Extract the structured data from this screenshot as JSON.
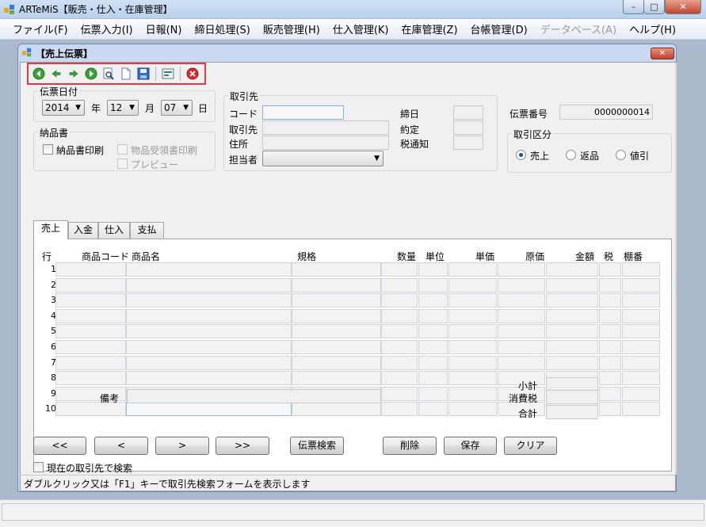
{
  "app": {
    "title": "ARTeMiS【販売・仕入・在庫管理】"
  },
  "menu": [
    {
      "label": "ファイル(F)",
      "enabled": true
    },
    {
      "label": "伝票入力(I)",
      "enabled": true
    },
    {
      "label": "日報(N)",
      "enabled": true
    },
    {
      "label": "締日処理(S)",
      "enabled": true
    },
    {
      "label": "販売管理(H)",
      "enabled": true
    },
    {
      "label": "仕入管理(K)",
      "enabled": true
    },
    {
      "label": "在庫管理(Z)",
      "enabled": true
    },
    {
      "label": "台帳管理(D)",
      "enabled": true
    },
    {
      "label": "データベース(A)",
      "enabled": false
    },
    {
      "label": "ヘルプ(H)",
      "enabled": true
    }
  ],
  "window": {
    "title": "【売上伝票】",
    "close_symbol": "✕",
    "min_symbol": "–",
    "max_symbol": "□"
  },
  "toolbar": [
    {
      "name": "first-record",
      "icon": "first-icon",
      "color": "#3aa23a"
    },
    {
      "name": "previous-record",
      "icon": "left-arrow-icon",
      "color": "#3aa23a"
    },
    {
      "name": "next-record",
      "icon": "right-arrow-icon",
      "color": "#3aa23a"
    },
    {
      "name": "last-record",
      "icon": "last-icon",
      "color": "#3aa23a"
    },
    {
      "name": "search",
      "icon": "magnifier-icon",
      "color": "#4a6fa5"
    },
    {
      "name": "new",
      "icon": "new-document-icon",
      "color": "#4a6fa5"
    },
    {
      "name": "save",
      "icon": "floppy-icon",
      "color": "#2d6fc2"
    },
    {
      "name": "print",
      "icon": "print-preview-icon",
      "color": "#3b8a3b"
    },
    {
      "name": "close",
      "icon": "close-circle-icon",
      "color": "#d03030"
    }
  ],
  "date_group": {
    "title": "伝票日付",
    "year": "2014",
    "year_unit": "年",
    "month": "12",
    "month_unit": "月",
    "day": "07",
    "day_unit": "日"
  },
  "delivery_group": {
    "title": "納品書",
    "print_delivery": {
      "label": "納品書印刷",
      "checked": false,
      "enabled": true
    },
    "print_receipt": {
      "label": "物品受領書印刷",
      "checked": false,
      "enabled": false
    },
    "preview": {
      "label": "プレビュー",
      "checked": false,
      "enabled": false
    }
  },
  "customer_group": {
    "title": "取引先",
    "code_label": "コード",
    "name_label": "取引先",
    "address_label": "住所",
    "staff_label": "担当者",
    "staff_value": "",
    "closing_label": "締日",
    "terms_label": "約定",
    "tax_label": "税通知"
  },
  "slip_number": {
    "label": "伝票番号",
    "value": "0000000014"
  },
  "transaction_type": {
    "title": "取引区分",
    "options": [
      "売上",
      "返品",
      "値引"
    ],
    "selected": 0
  },
  "tabs": [
    "売上",
    "入金",
    "仕入",
    "支払"
  ],
  "active_tab": 0,
  "grid": {
    "columns": [
      "行",
      "商品コード",
      "商品名",
      "規格",
      "数量",
      "単位",
      "単価",
      "原価",
      "金額",
      "税",
      "棚番"
    ],
    "rows": [
      "1",
      "2",
      "3",
      "4",
      "5",
      "6",
      "7",
      "8",
      "9",
      "10"
    ]
  },
  "remarks_label": "備考",
  "totals": {
    "subtotal_label": "小計",
    "tax_label": "消費税",
    "total_label": "合計"
  },
  "buttons": {
    "first": "<<",
    "prev": "<",
    "next": ">",
    "last": ">>",
    "slip_search": "伝票検索",
    "delete": "削除",
    "save": "保存",
    "clear": "クリア"
  },
  "search_current": {
    "label": "現在の取引先で検索",
    "checked": false
  },
  "status_text": "ダブルクリック又は「F1」キーで取引先検索フォームを表示します"
}
